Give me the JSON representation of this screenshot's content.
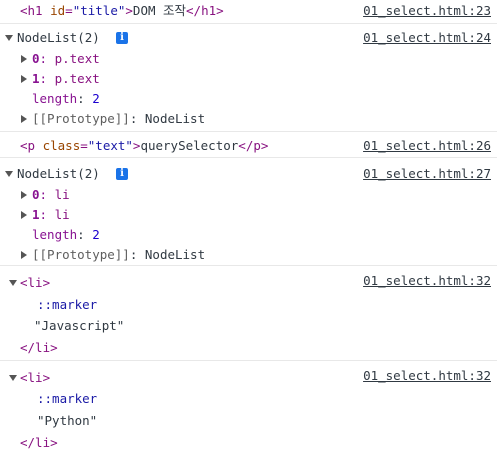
{
  "entries": [
    {
      "source": "01_select.html:23",
      "h1_open_tag": "<h1",
      "h1_attr": "id",
      "h1_eq": "=",
      "h1_val": "\"title\"",
      "h1_close_bracket": ">",
      "h1_text": "DOM 조작",
      "h1_close_tag": "</h1>"
    },
    {
      "source": "01_select.html:24",
      "header": "NodeList(2)",
      "items": [
        {
          "index": "0",
          "sep": ": ",
          "value": "p.text"
        },
        {
          "index": "1",
          "sep": ": ",
          "value": "p.text"
        }
      ],
      "length_key": "length",
      "length_sep": ": ",
      "length_val": "2",
      "proto": "[[Prototype]]",
      "proto_sep": ": ",
      "proto_val": "NodeList"
    },
    {
      "source": "01_select.html:26",
      "p_open_tag": "<p",
      "p_attr": "class",
      "p_eq": "=",
      "p_val": "\"text\"",
      "p_close_bracket": ">",
      "p_text": "querySelector",
      "p_close_tag": "</p>"
    },
    {
      "source": "01_select.html:27",
      "header": "NodeList(2)",
      "items": [
        {
          "index": "0",
          "sep": ": ",
          "value": "li"
        },
        {
          "index": "1",
          "sep": ": ",
          "value": "li"
        }
      ],
      "length_key": "length",
      "length_sep": ": ",
      "length_val": "2",
      "proto": "[[Prototype]]",
      "proto_sep": ": ",
      "proto_val": "NodeList"
    },
    {
      "source": "01_select.html:32",
      "open_tag": "<li>",
      "marker": "::marker",
      "text": "\"Javascript\"",
      "close_tag": "</li>"
    },
    {
      "source": "01_select.html:32",
      "open_tag": "<li>",
      "marker": "::marker",
      "text": "\"Python\"",
      "close_tag": "</li>"
    }
  ],
  "icons": {
    "info": "i"
  }
}
